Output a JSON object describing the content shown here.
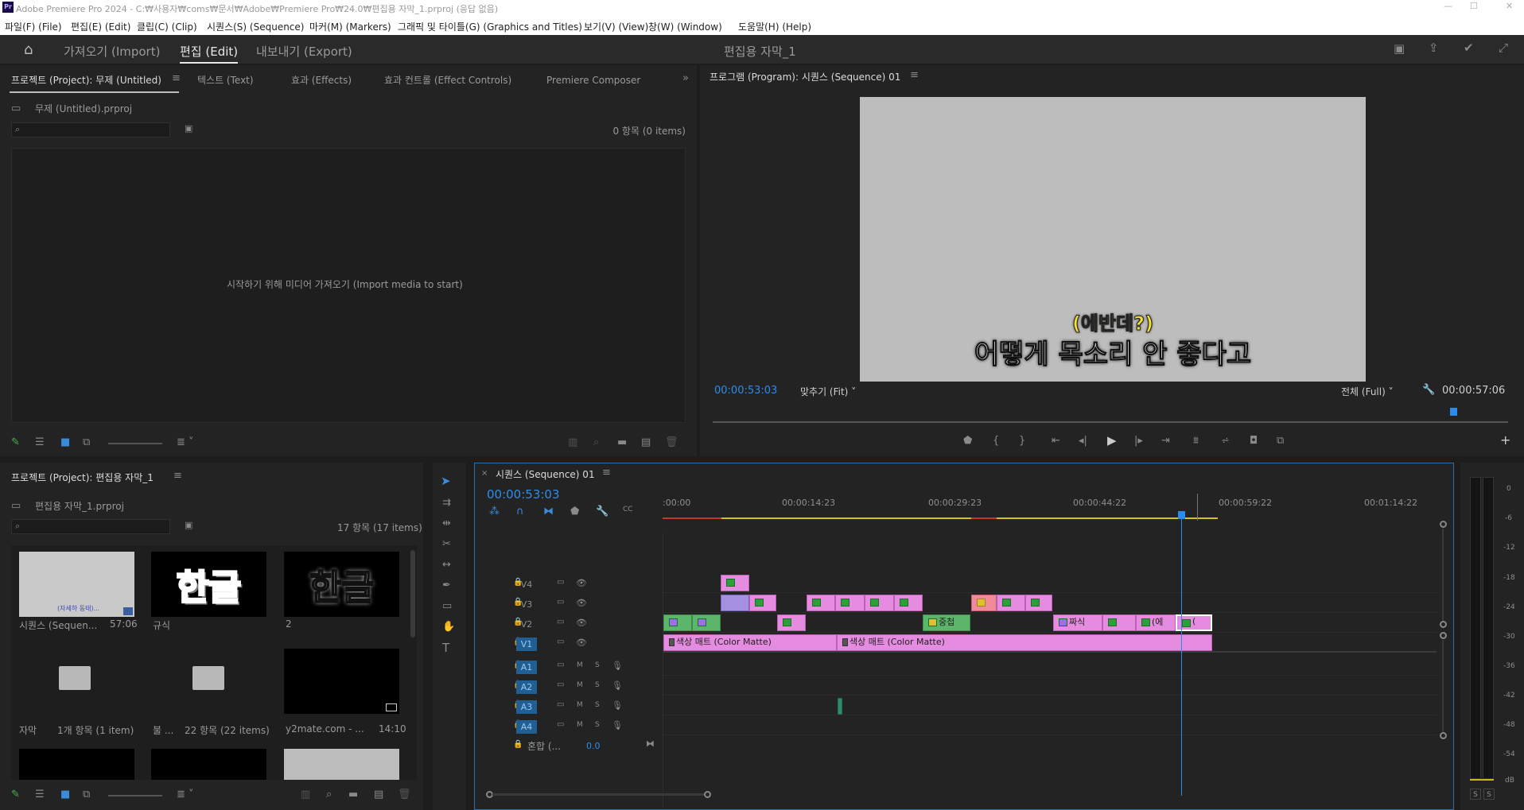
{
  "window": {
    "title": "Adobe Premiere Pro 2024 - C:₩사용자₩coms₩문서₩Adobe₩Premiere Pro₩24.0₩편집용 자막_1.prproj (응답 없음)",
    "app_badge": "Pr"
  },
  "menu": [
    "파일(F) (File)",
    "편집(E) (Edit)",
    "클립(C) (Clip)",
    "시퀀스(S) (Sequence)",
    "마커(M) (Markers)",
    "그래픽 및 타이틀(G) (Graphics and Titles)",
    "보기(V) (View)",
    "창(W) (Window)",
    "도움말(H) (Help)"
  ],
  "workspace": {
    "tabs": [
      "가져오기 (Import)",
      "편집 (Edit)",
      "내보내기 (Export)"
    ],
    "active": "편집 (Edit)",
    "project_name": "편집용 자막_1"
  },
  "project1": {
    "tabs": [
      "프로젝트 (Project): 무제 (Untitled)",
      "텍스트 (Text)",
      "효과 (Effects)",
      "효과 컨트롤 (Effect Controls)",
      "Premiere Composer"
    ],
    "file": "무제 (Untitled).prproj",
    "count": "0 항목 (0 items)",
    "empty_msg": "시작하기 위해 미디어 가져오기 (Import media to start)"
  },
  "program": {
    "title": "프로그램 (Program): 시퀀스 (Sequence) 01",
    "sub1": "(에반데?)",
    "sub2": "어떻게 목소리 안 좋다고",
    "timecode": "00:00:53:03",
    "fit": "맞추기 (Fit)",
    "quality": "전체 (Full)",
    "duration": "00:00:57:06"
  },
  "project2": {
    "title": "프로젝트 (Project): 편집용 자막_1",
    "file": "편집용 자막_1.prproj",
    "count": "17 항목 (17 items)",
    "items": [
      {
        "name": "시퀀스 (Sequen...",
        "meta": "57:06",
        "thumb_text": "(자세하 동태)..."
      },
      {
        "name": "규식",
        "meta": "",
        "thumb_text": "한글"
      },
      {
        "name": "2",
        "meta": "",
        "thumb_text": "한글"
      },
      {
        "name": "자막",
        "meta": "1개 항목 (1 item)",
        "thumb_text": ""
      },
      {
        "name": "불 ...",
        "meta": "22 항목 (22 items)",
        "thumb_text": ""
      },
      {
        "name": "y2mate.com - ...",
        "meta": "14:10",
        "thumb_text": ""
      }
    ]
  },
  "timeline": {
    "title": "시퀀스 (Sequence) 01",
    "timecode": "00:00:53:03",
    "ticks": [
      ":00:00",
      "00:00:14:23",
      "00:00:29:23",
      "00:00:44:22",
      "00:00:59:22",
      "00:01:14:22"
    ],
    "video_tracks": [
      "V4",
      "V3",
      "V2",
      "V1"
    ],
    "audio_tracks": [
      "A1",
      "A2",
      "A3",
      "A4"
    ],
    "mix_label": "혼합 (...",
    "mix_value": "0.0",
    "clip_texts": {
      "v1a": "색상 매트 (Color Matte)",
      "v1b": "색상 매트 (Color Matte)",
      "v2a": "중첩",
      "v2b": "짜식",
      "v2c": "(에",
      "v2d": "("
    }
  },
  "meter": {
    "scale": [
      "0",
      "-6",
      "-12",
      "-18",
      "-24",
      "-30",
      "-36",
      "-42",
      "-48",
      "-54",
      "dB"
    ],
    "solo": "S"
  },
  "colors": {
    "accent": "#2d8ceb",
    "clip_pink": "#e58be0",
    "clip_green": "#5bb56a",
    "playhead": "#2d8ceb"
  }
}
